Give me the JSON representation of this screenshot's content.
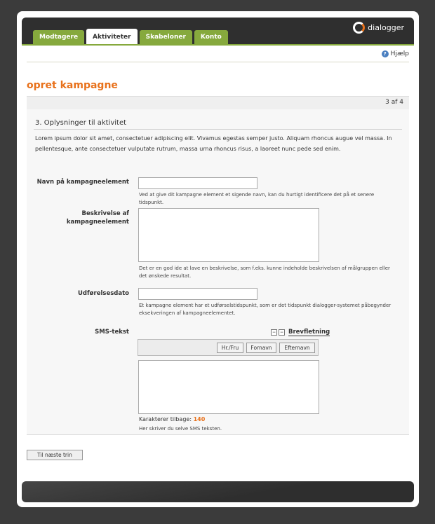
{
  "tabs": [
    {
      "label": "Modtagere"
    },
    {
      "label": "Aktiviteter"
    },
    {
      "label": "Skabeloner"
    },
    {
      "label": "Konto"
    }
  ],
  "logo_text": "dialogger",
  "help_label": "Hjælp",
  "page_title": "opret kampagne",
  "step_indicator": "3 af 4",
  "section_title": "3. Oplysninger til aktivitet",
  "intro_text": "Lorem ipsum dolor sit amet, consectetuer adipiscing elit. Vivamus egestas semper justo. Aliquam rhoncus augue vel massa. In pellentesque, ante consectetuer vulputate rutrum, massa urna rhoncus risus, a laoreet nunc pede sed enim.",
  "fields": {
    "name": {
      "label": "Navn på kampagneelement",
      "value": "",
      "hint": "Ved at give dit kampagne element et sigende navn, kan du hurtigt identificere det på et senere tidspunkt."
    },
    "description": {
      "label": "Beskrivelse af kampagneelement",
      "value": "",
      "hint": "Det er en god ide at lave en beskrivelse, som f.eks. kunne indeholde beskrivelsen af målgruppen eller det ønskede resultat."
    },
    "date": {
      "label": "Udførelsesdato",
      "value": "",
      "hint": "Et kampagne element har et udførselstidspunkt, som er det tidspunkt dialogger-systemet påbegynder eksekveringen af kampagneelementet."
    },
    "sms": {
      "label": "SMS-tekst",
      "value": "",
      "merge_label": "Brevfletning",
      "merge_buttons": [
        "Hr./Fru",
        "Fornavn",
        "Efternavn"
      ],
      "counter_label": "Karakterer tilbage:",
      "counter_value": "140",
      "hint": "Her skriver du selve SMS teksten."
    }
  },
  "next_button": "Til næste trin",
  "colors": {
    "accent_orange": "#e8711b",
    "tab_green": "#86a93d",
    "dark_bg": "#3b3b3b"
  }
}
